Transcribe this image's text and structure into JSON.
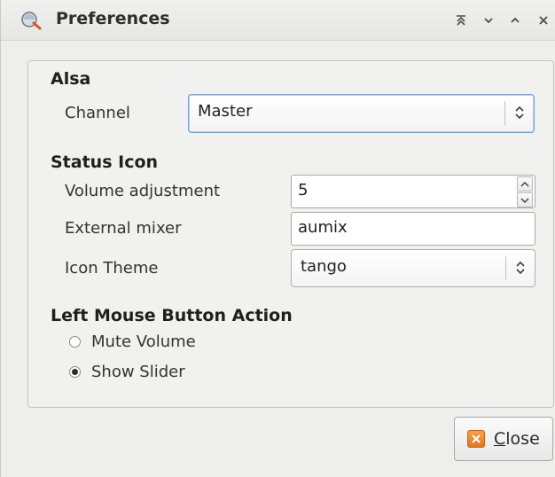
{
  "window": {
    "title": "Preferences",
    "icon": "search-icon",
    "controls": [
      "shade-icon",
      "minimize-icon",
      "maximize-icon",
      "close-window-icon"
    ]
  },
  "alsa": {
    "heading": "Alsa",
    "channel_label": "Channel",
    "channel_value": "Master"
  },
  "status_icon": {
    "heading": "Status Icon",
    "volume_label": "Volume adjustment",
    "volume_value": "5",
    "mixer_label": "External mixer",
    "mixer_value": "aumix",
    "theme_label": "Icon Theme",
    "theme_value": "tango"
  },
  "left_mouse": {
    "heading": "Left Mouse Button Action",
    "options": [
      {
        "label": "Mute Volume",
        "checked": false
      },
      {
        "label": "Show Slider",
        "checked": true
      }
    ]
  },
  "footer": {
    "close_label_first": "C",
    "close_label_rest": "lose"
  },
  "colors": {
    "focus_border": "#7aa0d0",
    "close_icon": "#e3761f"
  }
}
